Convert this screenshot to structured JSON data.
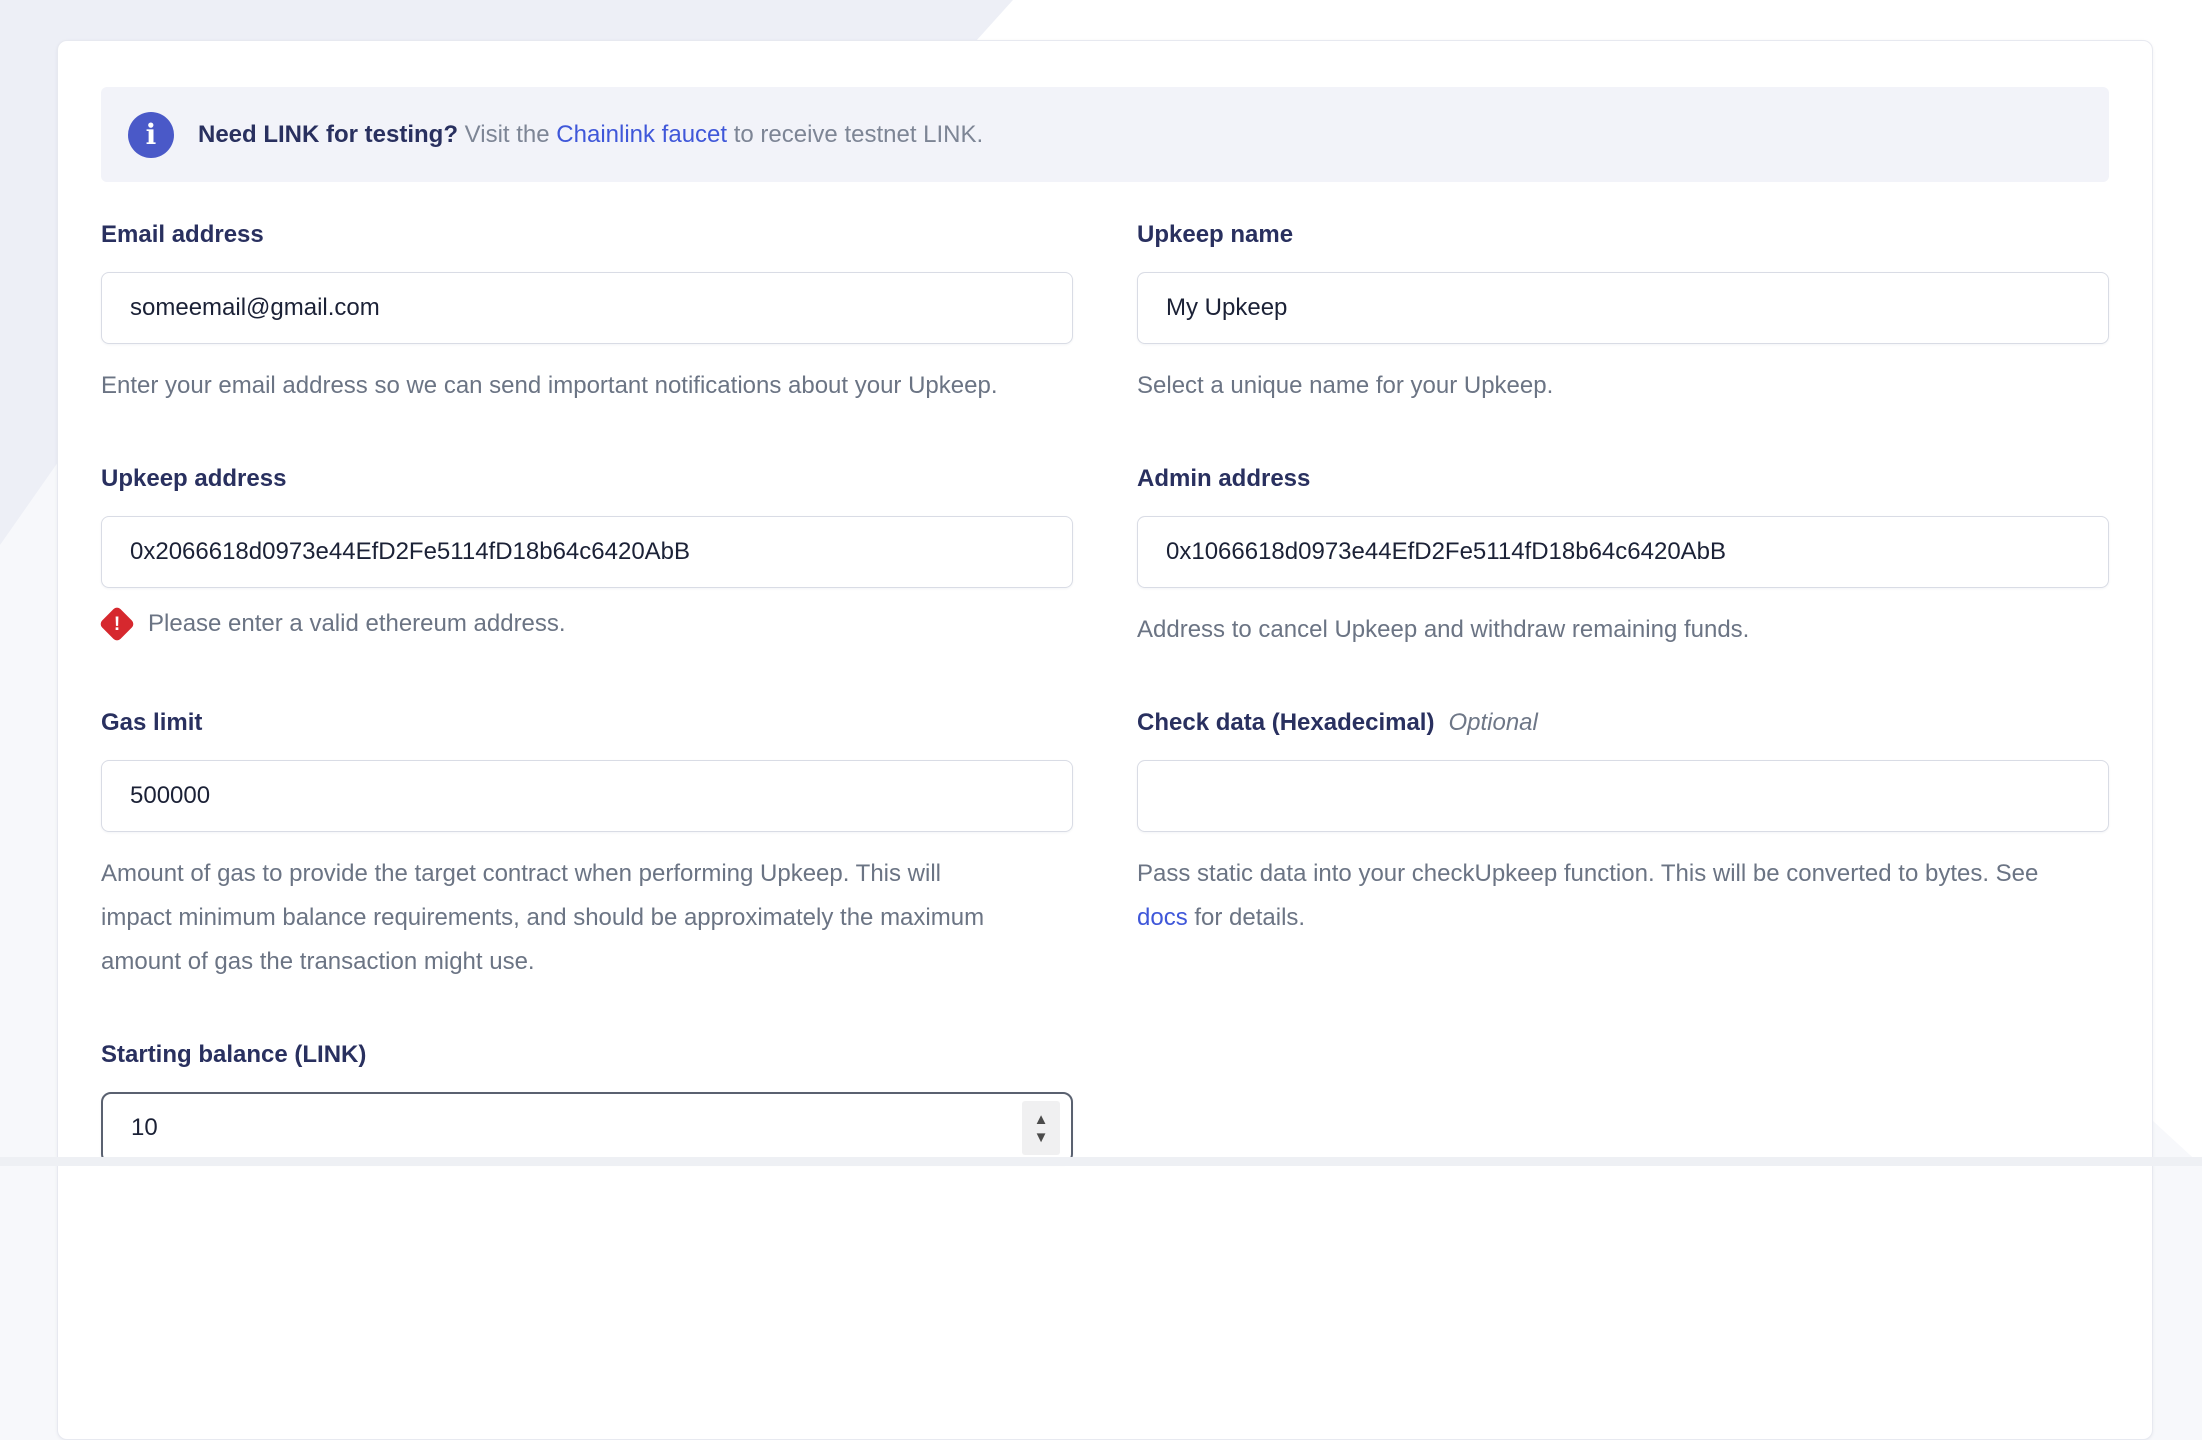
{
  "banner": {
    "bold": "Need LINK for testing?",
    "pre_link": " Visit the ",
    "link": "Chainlink faucet",
    "post_link": " to receive testnet LINK."
  },
  "icons": {
    "info": "i",
    "error": "!",
    "spin_up": "▲",
    "spin_down": "▼"
  },
  "fields": {
    "email": {
      "label": "Email address",
      "value": "someemail@gmail.com",
      "helper": "Enter your email address so we can send important notifications about your Upkeep."
    },
    "upkeep_name": {
      "label": "Upkeep name",
      "value": "My Upkeep",
      "helper": "Select a unique name for your Upkeep."
    },
    "upkeep_address": {
      "label": "Upkeep address",
      "value": "0x2066618d0973e44EfD2Fe5114fD18b64c6420AbB",
      "error": "Please enter a valid ethereum address."
    },
    "admin_address": {
      "label": "Admin address",
      "value": "0x1066618d0973e44EfD2Fe5114fD18b64c6420AbB",
      "helper": "Address to cancel Upkeep and withdraw remaining funds."
    },
    "gas_limit": {
      "label": "Gas limit",
      "value": "500000",
      "helper": "Amount of gas to provide the target contract when performing Upkeep. This will\nimpact minimum balance requirements, and should be approximately the maximum\namount of gas the transaction might use."
    },
    "check_data": {
      "label": "Check data (Hexadecimal)",
      "optional": "Optional",
      "value": "",
      "helper_pre": "Pass static data into your checkUpkeep function. This will be converted to bytes. See",
      "helper_link": "docs",
      "helper_post": " for details."
    },
    "starting_balance": {
      "label": "Starting balance (LINK)",
      "value": "10"
    }
  },
  "colors": {
    "navy": "#29305f",
    "link": "#3f57d9",
    "info-bg": "#4a59c8",
    "error": "#d6282e",
    "banner-bg": "#f2f3f9",
    "page": "#f7f8fb",
    "page-dark": "#edeff6"
  }
}
